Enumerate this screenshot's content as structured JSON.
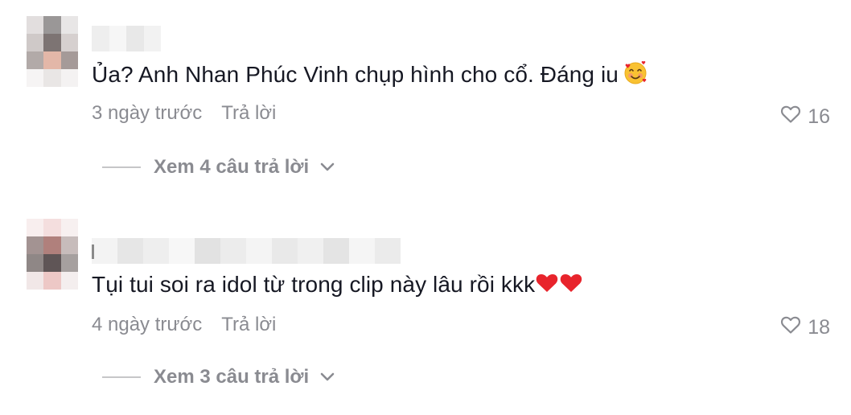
{
  "comments": [
    {
      "username": "",
      "text": "Ủa? Anh Nhan Phúc Vinh chụp hình cho cổ. Đáng iu",
      "emoji": "smiling-face-with-hearts",
      "time": "3 ngày trước",
      "reply_label": "Trả lời",
      "likes": "16",
      "view_replies": "Xem 4 câu trả lời",
      "avatar_colors": [
        "#e2dede",
        "#9a9797",
        "#e8e6e6",
        "#cfc9c8",
        "#7d7473",
        "#d6d0cf",
        "#b2aaa8",
        "#e3b7a8",
        "#a59a98",
        "#f6f4f4",
        "#e9e6e5",
        "#f4f2f2"
      ]
    },
    {
      "username": "",
      "text": "Tụi tui soi ra idol từ trong clip này lâu rồi kkk",
      "emoji": "red-hearts",
      "time": "4 ngày trước",
      "reply_label": "Trả lời",
      "likes": "18",
      "view_replies": "Xem 3 câu trả lời",
      "avatar_colors": [
        "#f8eeee",
        "#f4dede",
        "#f7f0f0",
        "#a39392",
        "#b0807c",
        "#c7bcbb",
        "#8f8786",
        "#5f5556",
        "#a6a09f",
        "#f1e7e7",
        "#edc8c6",
        "#f4eeee"
      ]
    }
  ],
  "accent_colors": {
    "text": "#161823",
    "muted": "#8a8b91",
    "heart": "#e8242c"
  }
}
